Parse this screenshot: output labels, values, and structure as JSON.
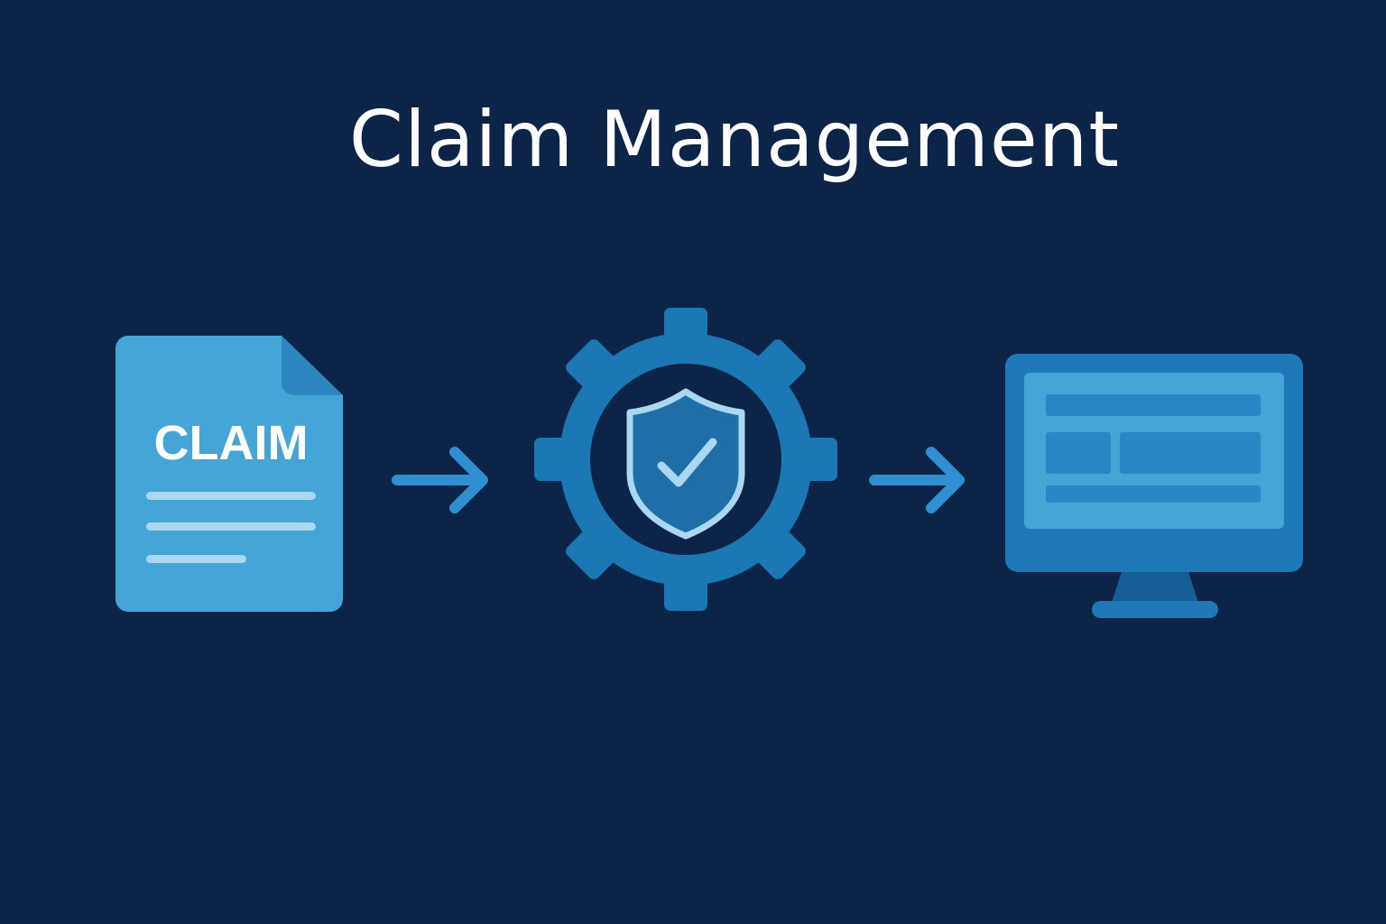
{
  "title": "Claim Management",
  "steps": [
    {
      "icon": "claim-document-icon",
      "label": "CLAIM"
    },
    {
      "icon": "gear-shield-check-icon"
    },
    {
      "icon": "computer-monitor-icon"
    }
  ],
  "colors": {
    "background": "#0b2447",
    "document": "#45a5d6",
    "document_fold": "#2e86c1",
    "document_lines": "#a9d8f0",
    "gear": "#1b78b4",
    "gear_inner": "#0b2447",
    "shield_fill": "#1f6ea8",
    "shield_stroke": "#a9d8f0",
    "arrow": "#2f8fd0",
    "monitor_frame": "#1f78b8",
    "monitor_screen": "#45a5d6",
    "monitor_blocks": "#2a86c4",
    "monitor_stand": "#155f96"
  }
}
